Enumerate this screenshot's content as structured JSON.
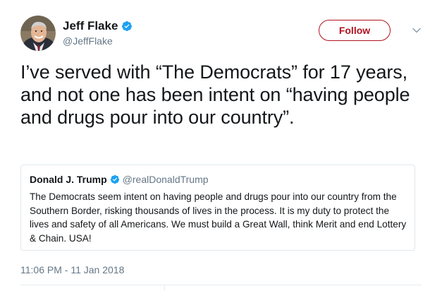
{
  "author": {
    "display_name": "Jeff Flake",
    "handle": "@JeffFlake",
    "verified": true
  },
  "follow_button": {
    "label": "Follow"
  },
  "menu": {
    "icon": "chevron-down-icon"
  },
  "tweet": {
    "text": "I’ve served with “The Democrats” for 17 years, and not one has been intent on “having people and drugs pour into our country”."
  },
  "quoted_tweet": {
    "display_name": "Donald J. Trump",
    "handle": "@realDonaldTrump",
    "verified": true,
    "text": "The Democrats seem intent on having people and drugs pour into our country from the Southern Border, risking thousands of lives in the process. It is my duty to protect the lives and safety of all Americans. We must build a Great Wall, think Merit and end Lottery & Chain. USA!"
  },
  "timestamp": "11:06 PM - 11 Jan 2018",
  "colors": {
    "follow_accent": "#b0131f",
    "verified_blue": "#1da1f2",
    "secondary_text": "#657786",
    "border": "#e1e8ed"
  }
}
